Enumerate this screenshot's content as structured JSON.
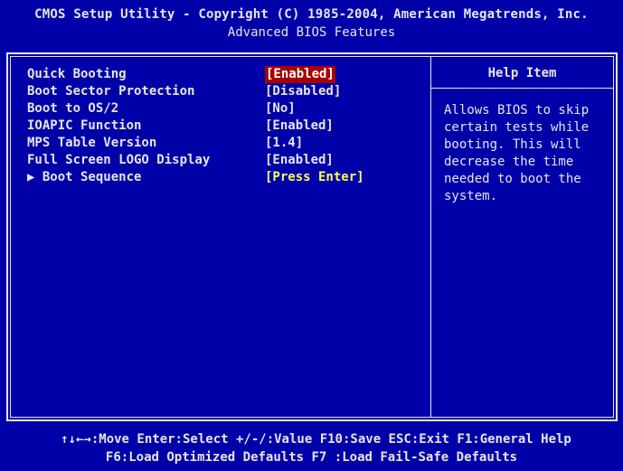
{
  "header": {
    "title": "CMOS Setup Utility - Copyright (C) 1985-2004, American Megatrends, Inc.",
    "subtitle": "Advanced BIOS Features"
  },
  "menu": {
    "items": [
      {
        "label": "Quick Booting",
        "value": "[Enabled]"
      },
      {
        "label": "Boot Sector Protection",
        "value": "[Disabled]"
      },
      {
        "label": "Boot to OS/2",
        "value": "[No]"
      },
      {
        "label": "IOAPIC Function",
        "value": "[Enabled]"
      },
      {
        "label": "MPS Table Version",
        "value": "[1.4]"
      },
      {
        "label": "Full Screen LOGO Display",
        "value": "[Enabled]"
      },
      {
        "label": "▶ Boot Sequence",
        "value": "[Press Enter]"
      }
    ],
    "selected_index": 0
  },
  "help": {
    "title": "Help Item",
    "text": "Allows BIOS to skip\ncertain tests while\nbooting. This will\ndecrease the time\nneeded to boot the\nsystem."
  },
  "footer": {
    "line1": "↑↓←→:Move  Enter:Select  +/-/:Value  F10:Save  ESC:Exit  F1:General Help",
    "line2": "F6:Load Optimized Defaults        F7 :Load Fail-Safe Defaults"
  },
  "colors": {
    "background": "#0000a8",
    "text": "#e6e6e6",
    "highlight": "#a80000",
    "submenu_value": "#ffff54"
  }
}
